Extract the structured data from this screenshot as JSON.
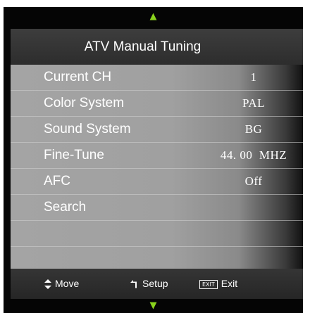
{
  "nav": {
    "up_arrow": "▲",
    "down_arrow": "▼"
  },
  "title": "ATV Manual Tuning",
  "menu": [
    {
      "label": "Current CH",
      "value": "1"
    },
    {
      "label": "Color System",
      "value": "PAL"
    },
    {
      "label": "Sound System",
      "value": "BG"
    },
    {
      "label": "Fine-Tune",
      "value": "44. 00  MHZ"
    },
    {
      "label": "AFC",
      "value": "Off"
    },
    {
      "label": "Search",
      "value": ""
    },
    {
      "label": "",
      "value": ""
    }
  ],
  "footer": {
    "move_label": "Move",
    "setup_label": "Setup",
    "exit_key": "EXIT",
    "exit_label": "Exit"
  },
  "colors": {
    "arrow": "#8ad31d",
    "title_bg": "#333333",
    "menu_bg": "#a2a2a2",
    "text": "#ffffff"
  },
  "icons": [
    "arrow-up-icon",
    "arrow-down-icon",
    "move-updown-icon",
    "setup-return-icon",
    "exit-key-icon"
  ]
}
